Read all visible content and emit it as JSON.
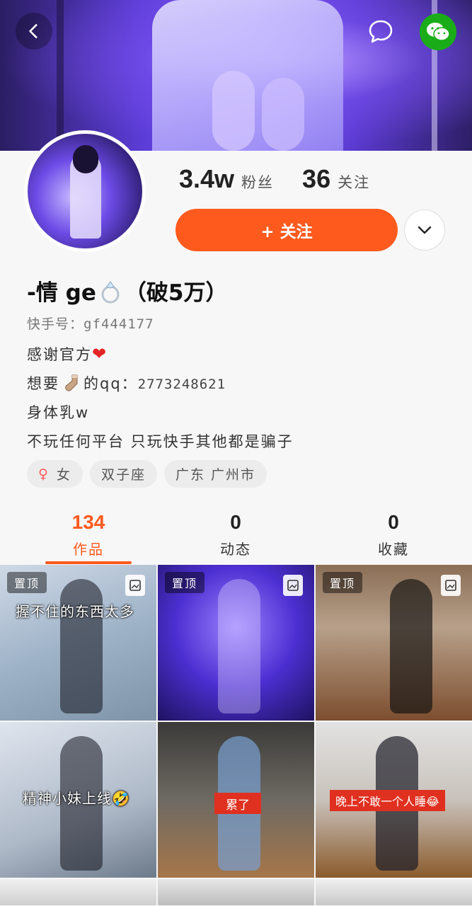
{
  "profile": {
    "followers_count": "3.4w",
    "followers_label": "粉丝",
    "following_count": "36",
    "following_label": "关注",
    "follow_button": "+ 关注",
    "nickname_pre": "-情 ge",
    "nickname_post": "（破5万）",
    "kuaishou_id": "快手号：gf444177",
    "bio": {
      "line1": "感谢官方",
      "line2_pre": "想要",
      "line2_post": "的qq：",
      "line2_qq": "2773248621",
      "line3": "身体乳w",
      "line4": "不玩任何平台 只玩快手其他都是骗子"
    },
    "tags": [
      "女",
      "双子座",
      "广东 广州市"
    ]
  },
  "tabs": [
    {
      "count": "134",
      "label": "作品"
    },
    {
      "count": "0",
      "label": "动态"
    },
    {
      "count": "0",
      "label": "收藏"
    }
  ],
  "videos": [
    {
      "pinned": "置顶",
      "caption": "握不住的东西太多"
    },
    {
      "pinned": "置顶",
      "caption": ""
    },
    {
      "pinned": "置顶",
      "caption": ""
    },
    {
      "pinned": "",
      "caption": "精神小妹上线🤣"
    },
    {
      "pinned": "",
      "caption": "累了"
    },
    {
      "pinned": "",
      "caption": "晚上不敢一个人睡😂"
    }
  ],
  "colors": {
    "accent": "#ff5a1e",
    "wechat": "#1aad19"
  },
  "icons": [
    "back-arrow-icon",
    "message-bubble-icon",
    "wechat-icon",
    "chevron-down-icon",
    "ring-icon",
    "heart-icon",
    "sock-icon",
    "female-icon",
    "photo-album-icon"
  ]
}
